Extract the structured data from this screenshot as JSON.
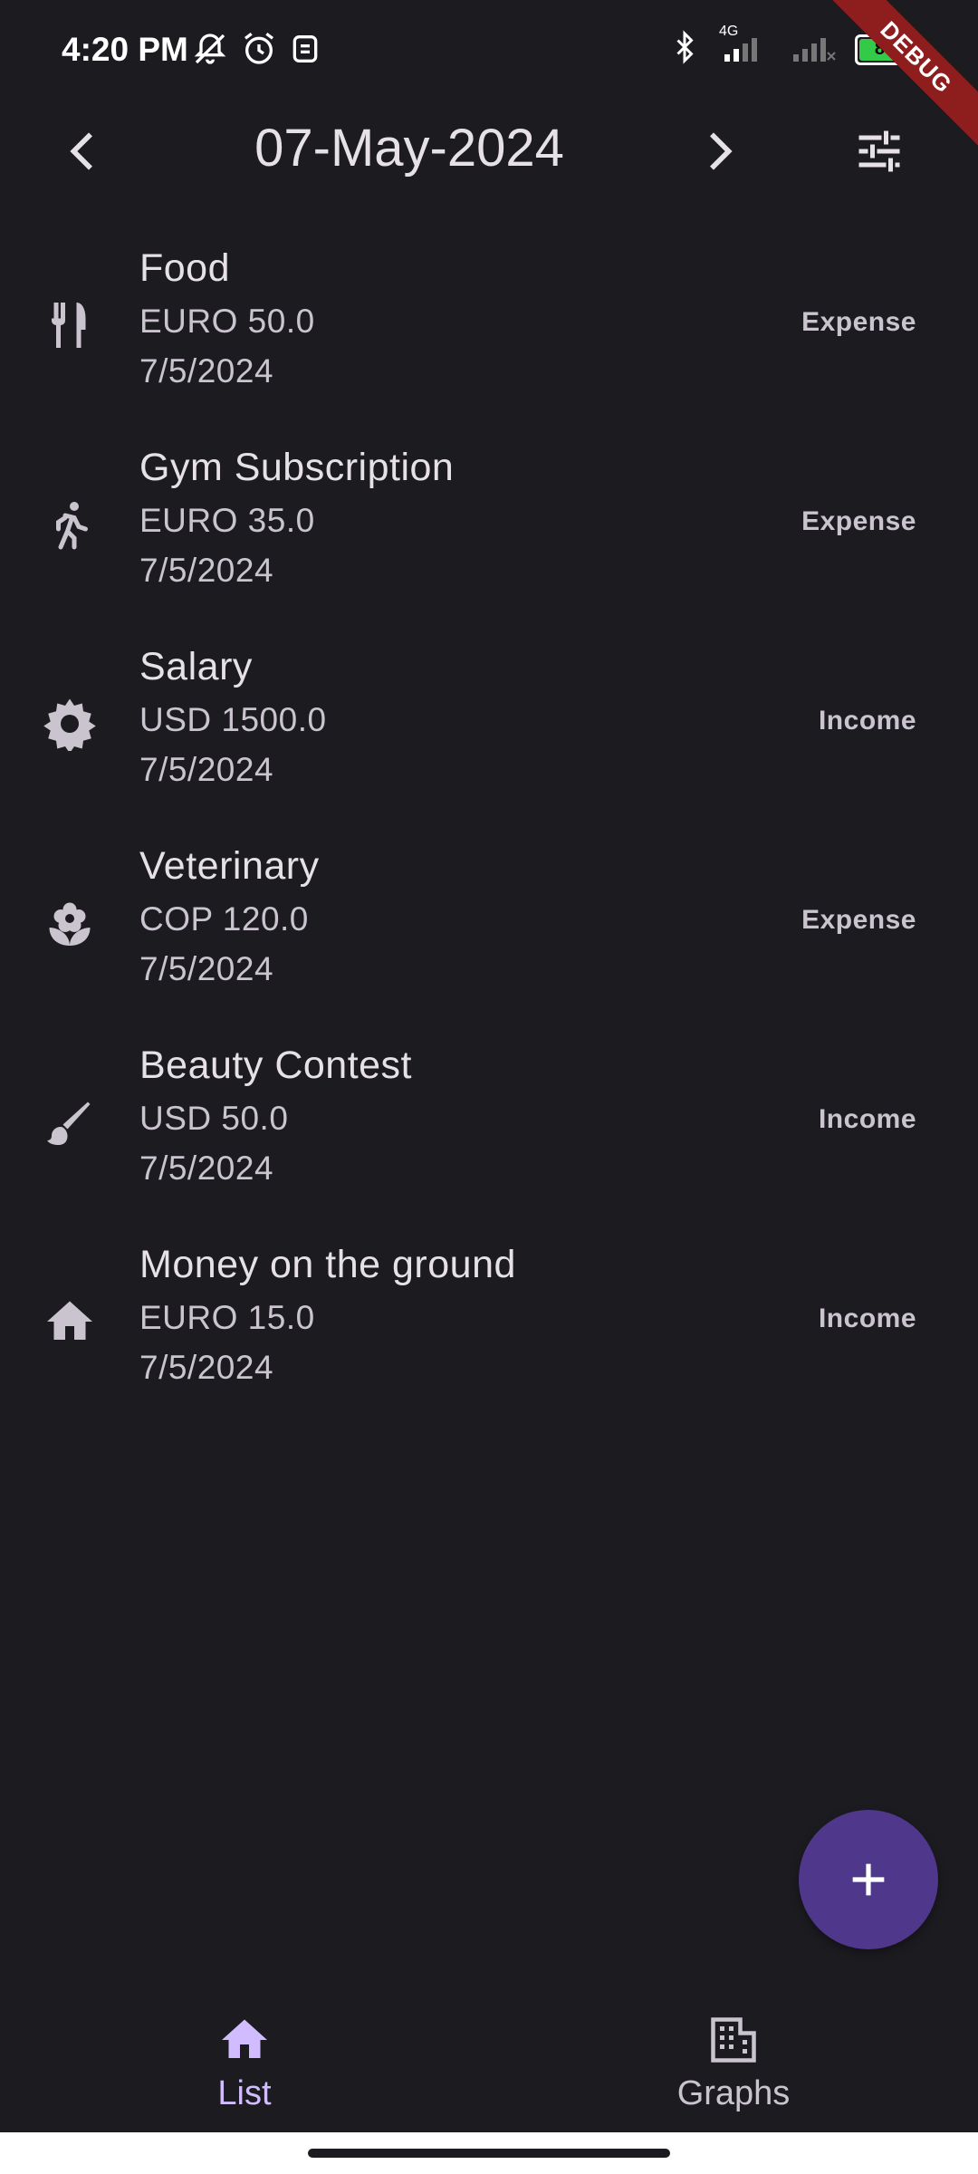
{
  "status_bar": {
    "time": "4:20 PM",
    "network": "4G",
    "battery": "84",
    "debug": "DEBUG"
  },
  "app_bar": {
    "date": "07-May-2024"
  },
  "transactions": [
    {
      "title": "Food",
      "amount": "EURO 50.0",
      "date": "7/5/2024",
      "type": "Expense",
      "icon": "restaurant-icon"
    },
    {
      "title": "Gym Subscription",
      "amount": "EURO 35.0",
      "date": "7/5/2024",
      "type": "Expense",
      "icon": "run-icon"
    },
    {
      "title": "Salary",
      "amount": "USD 1500.0",
      "date": "7/5/2024",
      "type": "Income",
      "icon": "settings-icon"
    },
    {
      "title": "Veterinary",
      "amount": "COP 120.0",
      "date": "7/5/2024",
      "type": "Expense",
      "icon": "flower-icon"
    },
    {
      "title": "Beauty Contest",
      "amount": "USD 50.0",
      "date": "7/5/2024",
      "type": "Income",
      "icon": "brush-icon"
    },
    {
      "title": "Money on the ground",
      "amount": "EURO 15.0",
      "date": "7/5/2024",
      "type": "Income",
      "icon": "home-icon"
    }
  ],
  "bottom_nav": {
    "list_label": "List",
    "graphs_label": "Graphs"
  },
  "colors": {
    "background": "#1c1b20",
    "fab": "#4f378b",
    "active_nav": "#d0bcff"
  }
}
